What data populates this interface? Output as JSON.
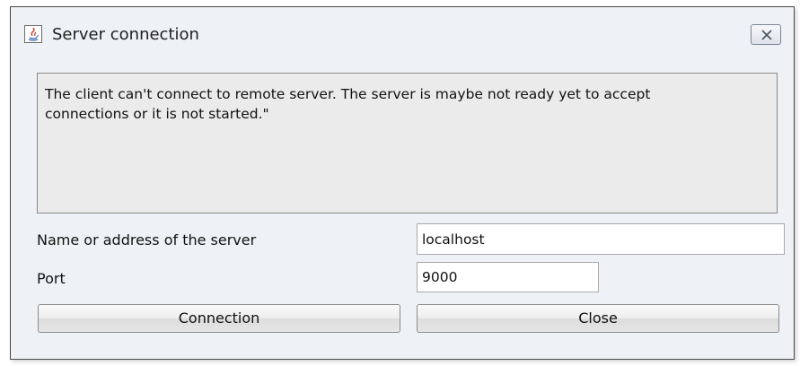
{
  "window": {
    "title": "Server connection",
    "icon": "java-app-icon",
    "close_icon": "close-icon"
  },
  "message": "The client can't connect to remote server. The server is maybe not ready yet to accept\nconnections or it is not started.\"",
  "form": {
    "server_label": "Name or address of the server",
    "server_value": "localhost",
    "port_label": "Port",
    "port_value": "9000"
  },
  "buttons": {
    "connection_label": "Connection",
    "close_label": "Close"
  }
}
